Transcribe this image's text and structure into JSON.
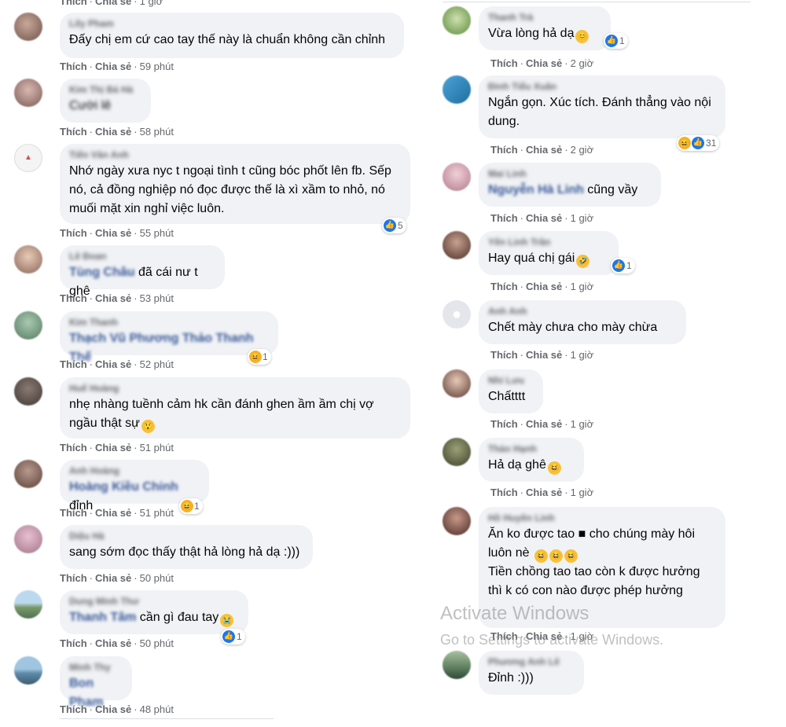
{
  "labels": {
    "like": "Thích",
    "share": "Chia sẻ",
    "sep": "·"
  },
  "top_time": "1 giờ",
  "left_comments": [
    {
      "author": "Lily Pham",
      "text": "Đấy chị em cứ cao tay thế này là chuẩn không cần chỉnh",
      "time": "59 phút"
    },
    {
      "author": "Kim Thị Bá Hà",
      "text": "Cười lê",
      "time": "58 phút"
    },
    {
      "author": "Tiến Văn Anh",
      "text": "Nhớ ngày xưa nyc t ngoại tình t cũng bóc phốt lên fb. Sếp nó, cả đồng nghiệp nó đọc được thế là xì xầm to nhỏ, nó muối mặt xin nghỉ việc luôn.",
      "time": "55 phút",
      "reaction_count": "5"
    },
    {
      "author": "Lê Đoan",
      "mention": "Tùng Châu",
      "text": " đã cái nư t ghê",
      "time": "53 phút"
    },
    {
      "author": "Kim Thanh",
      "mention": "Thạch Vũ Phương Thảo Thanh Thế",
      "text": "",
      "time": "52 phút",
      "reaction_count": "1"
    },
    {
      "author": "Huế Hoàng",
      "text": "nhẹ nhàng tuềnh cảm hk cần đánh ghen ầm ầm chị vợ ngầu thật sự",
      "time": "51 phút"
    },
    {
      "author": "Anh Hoàng",
      "mention": "Hoàng Kiều Chinh",
      "text": " đỉnh",
      "time": "51 phút",
      "reaction_count": "1"
    },
    {
      "author": "Diệu Hà",
      "text": "sang sớm đọc thấy thật hả lòng hả dạ :)))",
      "time": "50 phút"
    },
    {
      "author": "Dung Minh Thư",
      "mention": "Thanh Tâm",
      "text": " cần gì đau tay",
      "time": "50 phút",
      "reaction_count": "1"
    },
    {
      "author": "Minh Thy",
      "mention": "Bon Pham",
      "text": "",
      "time": "48 phút"
    }
  ],
  "right_comments": [
    {
      "author": "Thanh Trà",
      "text": "Vừa lòng hả dạ",
      "time": "2 giờ",
      "reaction_count": "1"
    },
    {
      "author": "Đinh Tiểu Xuân",
      "text": "Ngắn gọn. Xúc tích. Đánh thẳng vào nội dung.",
      "time": "2 giờ",
      "reaction_count": "31"
    },
    {
      "author": "Mai Linh",
      "mention": "Nguyễn Hà Linh",
      "text": " cũng vầy",
      "time": "1 giờ"
    },
    {
      "author": "Yến Linh Trần",
      "text": "Hay quá chị gái",
      "time": "1 giờ",
      "reaction_count": "1"
    },
    {
      "author": "Anh Anh",
      "text": "Chết mày chưa cho mày chừa",
      "time": "1 giờ"
    },
    {
      "author": "Nhi Lưu",
      "text": "Chấtttt",
      "time": "1 giờ"
    },
    {
      "author": "Thảo Hạnh",
      "text": "Hả dạ ghê",
      "time": "1 giờ"
    },
    {
      "author": "Hồ Huyền Linh",
      "text": "Ăn ko được tao ■ cho chúng mày hôi luôn nè",
      "text2": "Tiền chồng tao tao còn k được hưởng thì k có con nào được phép hưởng",
      "time": "1 giờ"
    },
    {
      "author": "Phương Anh Lê",
      "text": "Đỉnh :)))",
      "time": ""
    }
  ],
  "watermark": {
    "line1": "Activate Windows",
    "line2": "Go to Settings to activate Windows."
  },
  "colors": {
    "bubble": "#f0f2f5",
    "meta": "#65676b",
    "like": "#1877f2",
    "haha": "#f7b125"
  }
}
